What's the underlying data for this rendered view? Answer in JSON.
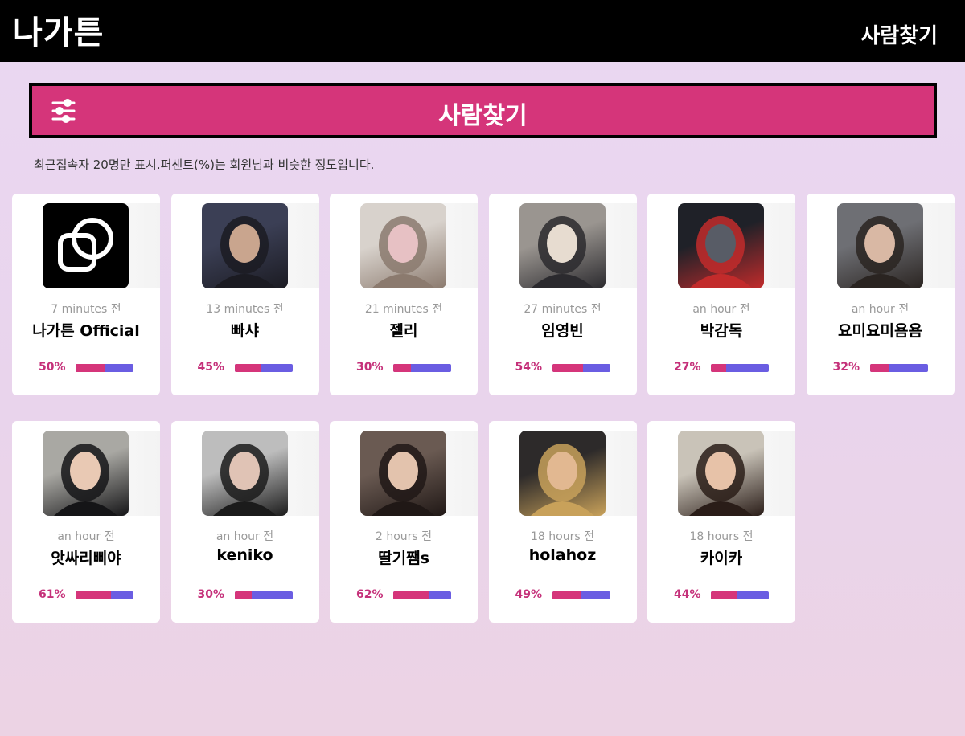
{
  "header": {
    "logo": "나가튼",
    "nav_link": "사람찾기"
  },
  "banner": {
    "icon": "filter-sliders-icon",
    "title": "사람찾기"
  },
  "notice": "최근접속자 20명만 표시.퍼센트(%)는 회원님과 비슷한 정도입니다.",
  "colors": {
    "accent": "#d5357a",
    "bar_rest": "#6a5de2",
    "percent_text": "#c5317a"
  },
  "users": [
    {
      "time": "7 minutes 전",
      "nickname": "나가튼 Official",
      "percent": "50%",
      "match": 0.5,
      "avatar": "official-logo-icon"
    },
    {
      "time": "13 minutes 전",
      "nickname": "빠샤",
      "percent": "45%",
      "match": 0.45,
      "avatar": "photo"
    },
    {
      "time": "21 minutes 전",
      "nickname": "젤리",
      "percent": "30%",
      "match": 0.3,
      "avatar": "photo"
    },
    {
      "time": "27 minutes 전",
      "nickname": "임영빈",
      "percent": "54%",
      "match": 0.54,
      "avatar": "photo"
    },
    {
      "time": "an hour 전",
      "nickname": "박감독",
      "percent": "27%",
      "match": 0.27,
      "avatar": "photo"
    },
    {
      "time": "an hour 전",
      "nickname": "요미요미욤욤",
      "percent": "32%",
      "match": 0.32,
      "avatar": "photo"
    },
    {
      "time": "an hour 전",
      "nickname": "앗싸리삐야",
      "percent": "61%",
      "match": 0.61,
      "avatar": "photo"
    },
    {
      "time": "an hour 전",
      "nickname": "keniko",
      "percent": "30%",
      "match": 0.3,
      "avatar": "photo"
    },
    {
      "time": "2 hours 전",
      "nickname": "딸기쨈s",
      "percent": "62%",
      "match": 0.62,
      "avatar": "photo"
    },
    {
      "time": "18 hours 전",
      "nickname": "holahoz",
      "percent": "49%",
      "match": 0.49,
      "avatar": "photo"
    },
    {
      "time": "18 hours 전",
      "nickname": "카이카",
      "percent": "44%",
      "match": 0.44,
      "avatar": "photo"
    }
  ]
}
